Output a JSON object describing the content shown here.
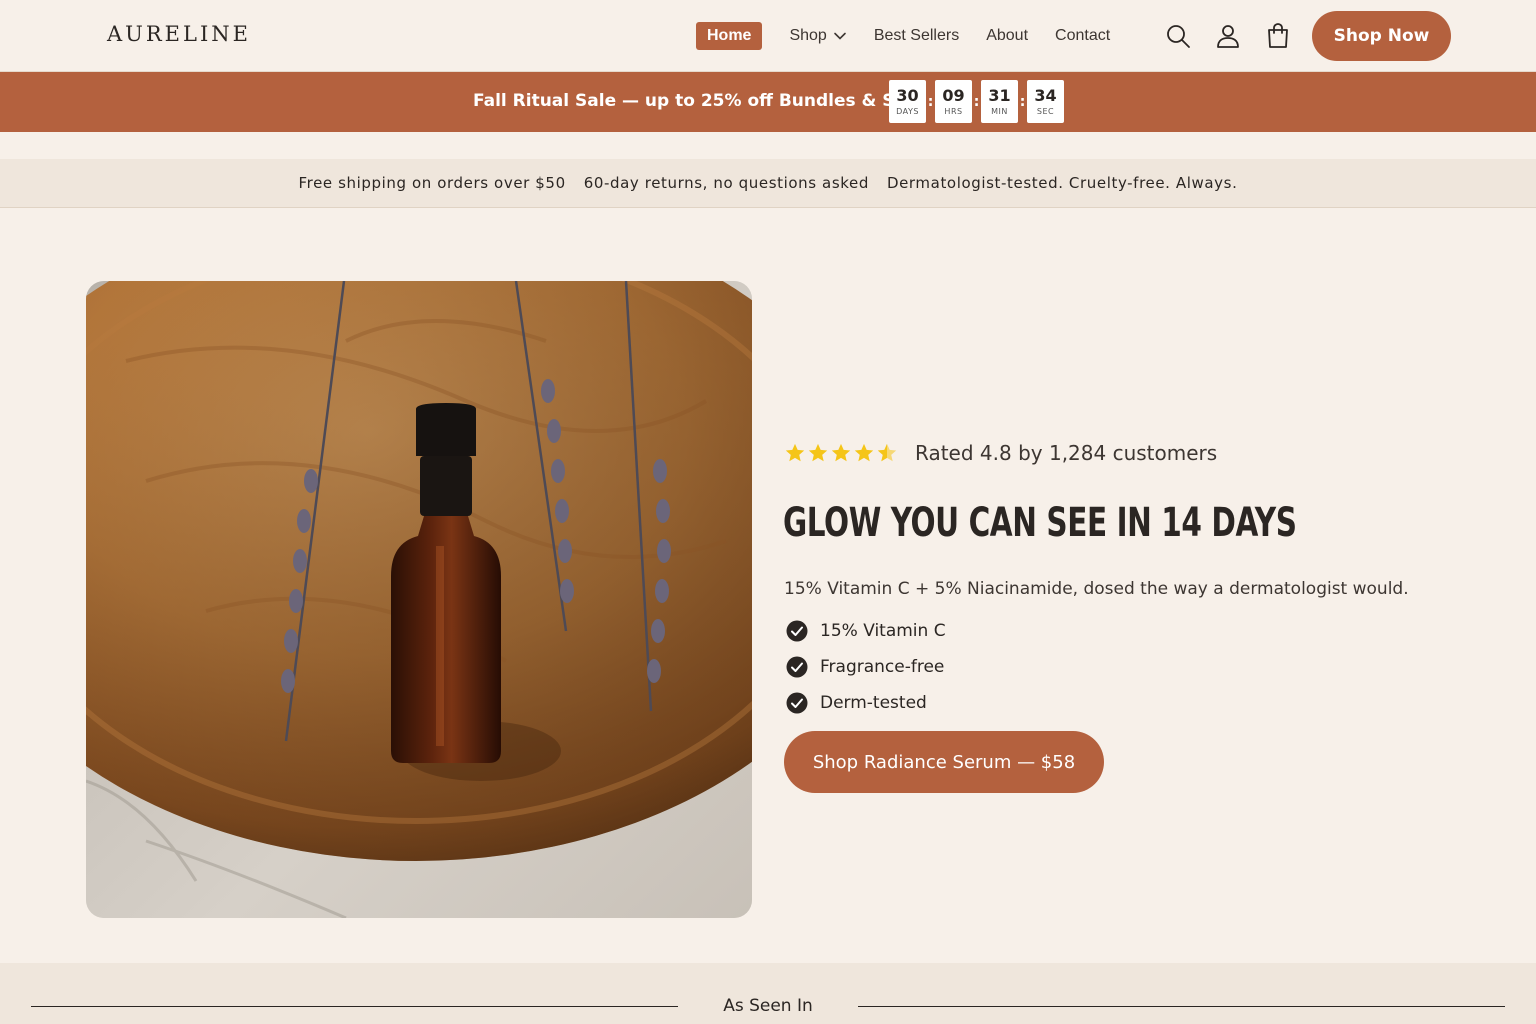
{
  "brand": {
    "logo_text": "AURELINE"
  },
  "nav": {
    "items": [
      {
        "label": "Home",
        "active": true
      },
      {
        "label": "Shop",
        "active": false,
        "dropdown": true
      },
      {
        "label": "Best Sellers",
        "active": false
      },
      {
        "label": "About",
        "active": false
      },
      {
        "label": "Contact",
        "active": false
      }
    ],
    "icons": [
      "search-icon",
      "user-icon",
      "shopping-bag-icon"
    ],
    "cta_label": "Shop Now"
  },
  "promo": {
    "text": "Fall Ritual Sale — up to 25% off Bundles & Sets",
    "countdown": [
      {
        "value": "30",
        "unit": "DAYS"
      },
      {
        "value": "09",
        "unit": "HRS"
      },
      {
        "value": "31",
        "unit": "MIN"
      },
      {
        "value": "34",
        "unit": "SEC"
      }
    ]
  },
  "trust": {
    "items": [
      "Free shipping on orders over $50",
      "60-day returns, no questions asked",
      "Dermatologist-tested. Cruelty-free. Always."
    ]
  },
  "hero": {
    "rating": {
      "stars": 4.8,
      "max": 5,
      "text": "Rated 4.8 by 1,284 customers"
    },
    "headline": "GLOW YOU CAN SEE IN 14 DAYS",
    "subhead": "15% Vitamin C + 5% Niacinamide, dosed the way a dermatologist would.",
    "features": [
      "15% Vitamin C",
      "Fragrance-free",
      "Derm-tested"
    ],
    "cta_label": "Shop Radiance Serum — $58"
  },
  "seen_in": {
    "title": "As Seen In"
  },
  "colors": {
    "accent": "#b4613e",
    "background": "#f7f0e9",
    "band": "#efe6dc",
    "text": "#2b2623",
    "star": "#f5c518"
  }
}
